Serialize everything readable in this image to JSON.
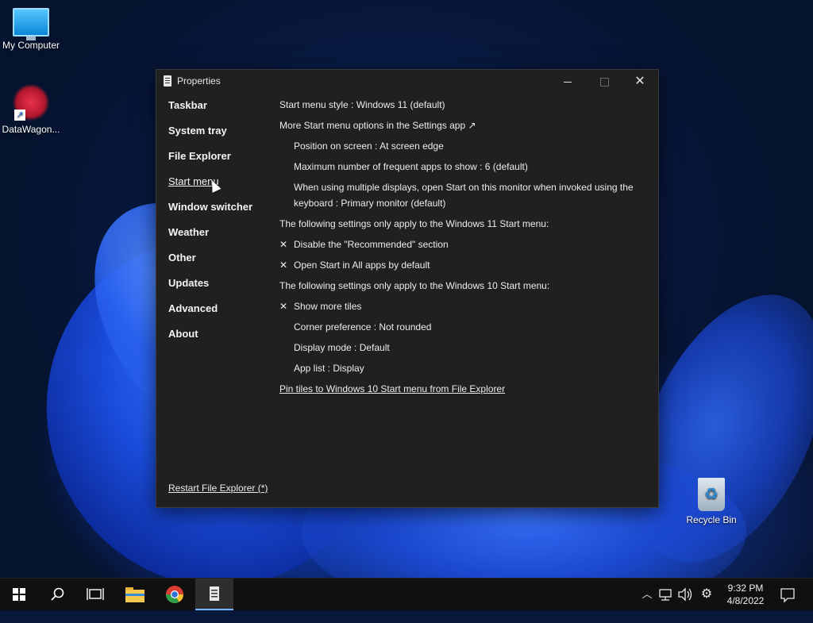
{
  "desktop": {
    "icons": [
      {
        "label": "My Computer"
      },
      {
        "label": "DataWagon..."
      },
      {
        "label": "Recycle Bin"
      }
    ]
  },
  "window": {
    "title": "Properties",
    "nav": [
      "Taskbar",
      "System tray",
      "File Explorer",
      "Start menu",
      "Window switcher",
      "Weather",
      "Other",
      "Updates",
      "Advanced",
      "About"
    ],
    "active_nav": "Start menu",
    "content": {
      "start_style": "Start menu style : Windows 11 (default)",
      "more_options": "More Start menu options in the Settings app ↗",
      "position": "Position on screen : At screen edge",
      "max_frequent": "Maximum number of frequent apps to show : 6 (default)",
      "multi_display": "When using multiple displays, open Start on this monitor when invoked using the keyboard : Primary monitor (default)",
      "win11_header": "The following settings only apply to the Windows 11 Start menu:",
      "disable_recommended": "Disable the \"Recommended\" section",
      "open_all_apps": "Open Start in All apps by default",
      "win10_header": "The following settings only apply to the Windows 10 Start menu:",
      "show_more_tiles": "Show more tiles",
      "corner_pref": "Corner preference : Not rounded",
      "display_mode": "Display mode : Default",
      "app_list": "App list : Display",
      "pin_tiles_link": "Pin tiles to Windows 10 Start menu from File Explorer",
      "check_mark": "✕"
    },
    "restart_link": "Restart File Explorer (*)"
  },
  "taskbar": {
    "clock_time": "9:32 PM",
    "clock_date": "4/8/2022"
  }
}
